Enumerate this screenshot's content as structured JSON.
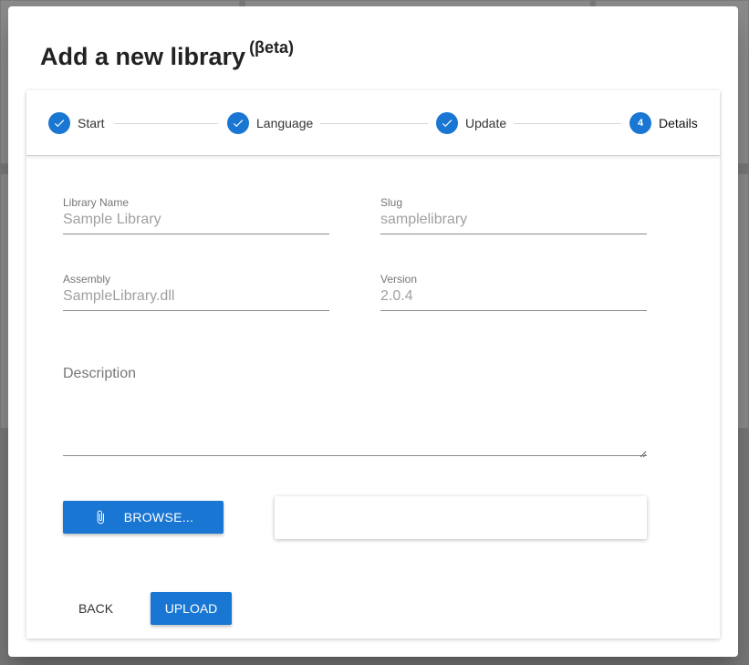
{
  "dialog": {
    "title": "Add a new library",
    "title_suffix": "(βeta)"
  },
  "stepper": {
    "steps": [
      {
        "label": "Start",
        "state": "complete",
        "icon": "check-icon"
      },
      {
        "label": "Language",
        "state": "complete",
        "icon": "check-icon"
      },
      {
        "label": "Update",
        "state": "complete",
        "icon": "check-icon"
      },
      {
        "label": "Details",
        "state": "active",
        "number": "4"
      }
    ]
  },
  "form": {
    "library_name": {
      "label": "Library Name",
      "value": "Sample Library"
    },
    "slug": {
      "label": "Slug",
      "value": "samplelibrary"
    },
    "assembly": {
      "label": "Assembly",
      "value": "SampleLibrary.dll"
    },
    "version": {
      "label": "Version",
      "value": "2.0.4"
    },
    "description": {
      "label": "Description",
      "value": ""
    }
  },
  "actions": {
    "browse_label": "BROWSE...",
    "back_label": "BACK",
    "upload_label": "UPLOAD"
  },
  "colors": {
    "primary": "#1976d2"
  }
}
